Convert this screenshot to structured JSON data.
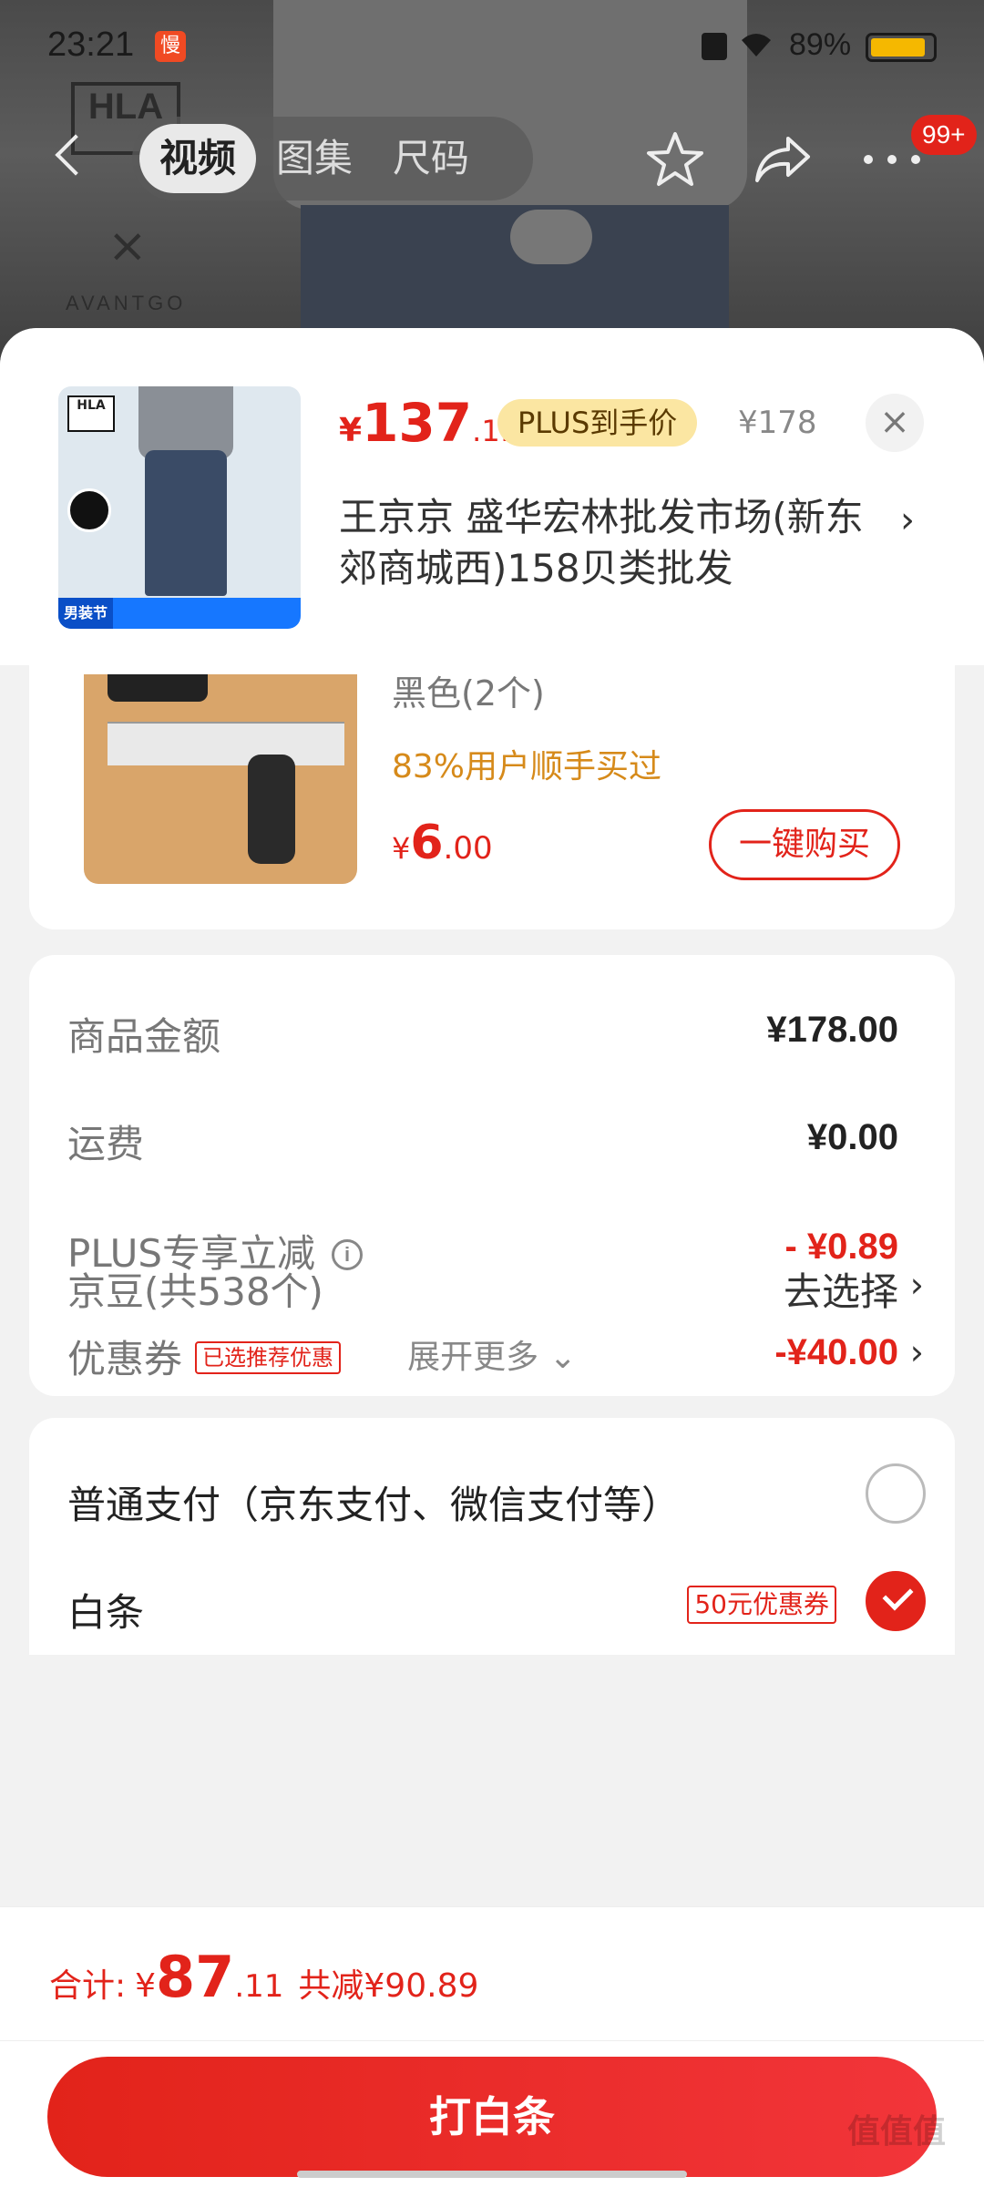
{
  "status_bar": {
    "time": "23:21",
    "app_badge": "慢",
    "battery_text": "89%",
    "battery_level": 0.89
  },
  "background": {
    "logo": "HLA",
    "brand": "AVANTGO"
  },
  "nav": {
    "tabs": [
      "视频",
      "图集",
      "尺码"
    ],
    "active_tab": 0,
    "more_badge": "99+"
  },
  "product": {
    "price_symbol": "¥",
    "price_int": "137",
    "price_dec": ".11",
    "plus_tag": "PLUS到手价",
    "original_price": "¥178",
    "address": "王京京  盛华宏林批发市场(新东郊商城西)158贝类批发",
    "thumb_logo": "HLA",
    "thumb_tag": "男装节"
  },
  "recommendation": {
    "variant": "黑色(2个)",
    "buyers": "83%用户顺手买过",
    "price_symbol": "¥",
    "price_int": "6",
    "price_dec": ".00",
    "buy_button": "一键购买"
  },
  "summary": {
    "rows": [
      {
        "label": "商品金额",
        "value": "¥178.00"
      },
      {
        "label": "运费",
        "value": "¥0.00"
      },
      {
        "label": "PLUS专享立减",
        "value": "- ¥0.89"
      },
      {
        "label": "优惠券",
        "tag": "已选推荐优惠",
        "value": "-¥40.00"
      },
      {
        "label": "京豆(共538个)",
        "value": "去选择"
      }
    ],
    "expand": "展开更多"
  },
  "payment": {
    "options": [
      {
        "label": "普通支付（京东支付、微信支付等）",
        "selected": false
      },
      {
        "label": "白条",
        "coupon": "50元优惠券",
        "selected": true
      }
    ]
  },
  "bottom": {
    "total_label": "合计:",
    "total_symbol": "¥",
    "total_int": "87",
    "total_dec": ".11",
    "saved": "共减¥90.89",
    "pay_button": "打白条"
  },
  "watermark": "值值值",
  "colors": {
    "accent": "#e2231a",
    "plus_gold": "#fbe6a2",
    "buyers_orange": "#d68a1a"
  }
}
